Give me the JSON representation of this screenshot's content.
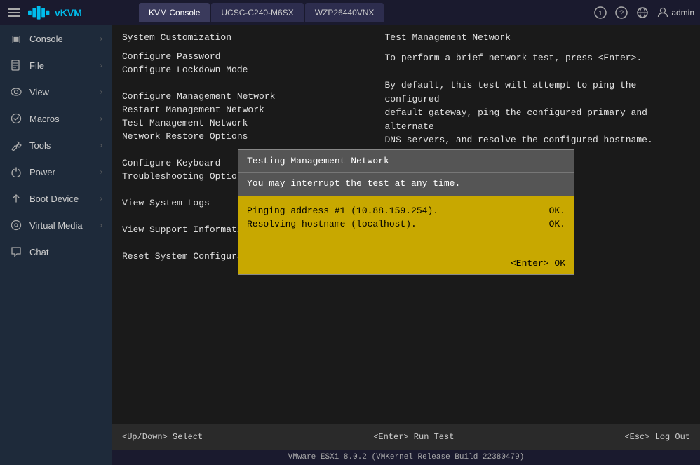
{
  "topbar": {
    "logo_text": "vKVM",
    "tabs": [
      {
        "label": "KVM Console",
        "active": true
      },
      {
        "label": "UCSC-C240-M6SX",
        "active": false
      },
      {
        "label": "WZP26440VNX",
        "active": false
      }
    ],
    "badge_count": "1",
    "user": "admin"
  },
  "sidebar": {
    "items": [
      {
        "label": "Console",
        "icon": "▣",
        "has_arrow": true
      },
      {
        "label": "File",
        "icon": "📄",
        "has_arrow": true
      },
      {
        "label": "View",
        "icon": "👁",
        "has_arrow": true
      },
      {
        "label": "Macros",
        "icon": "⚙",
        "has_arrow": true
      },
      {
        "label": "Tools",
        "icon": "🔧",
        "has_arrow": true
      },
      {
        "label": "Power",
        "icon": "⏻",
        "has_arrow": true
      },
      {
        "label": "Boot Device",
        "icon": "⬆",
        "has_arrow": true
      },
      {
        "label": "Virtual Media",
        "icon": "💿",
        "has_arrow": true
      },
      {
        "label": "Chat",
        "icon": "💬",
        "has_arrow": false
      }
    ]
  },
  "esxi": {
    "left_title": "System Customization",
    "menu_items": [
      "Configure Password",
      "Configure Lockdown Mode",
      "",
      "Configure Management Network",
      "Restart Management Network",
      "Test Management Network",
      "Network Restore Options",
      "",
      "Configure Keyboard",
      "Troubleshooting Options",
      "",
      "View System Logs",
      "",
      "View Support Information",
      "",
      "Reset System Configurati..."
    ],
    "right_title": "Test Management Network",
    "right_desc": "To perform a brief network test, press <Enter>.\n\nBy default, this test will attempt to ping the configured\ndefault gateway, ping the configured primary and alternate\nDNS servers, and resolve the configured hostname."
  },
  "dialog": {
    "title": "Testing Management Network",
    "body_text": "You may interrupt the test at any time.",
    "results": [
      {
        "label": "Pinging address #1 (10.88.159.254).",
        "status": "OK."
      },
      {
        "label": "Resolving hostname (localhost).",
        "status": "OK."
      }
    ],
    "footer": "<Enter> OK"
  },
  "status_bar": {
    "left": "<Up/Down> Select",
    "center": "<Enter> Run Test",
    "right": "<Esc> Log Out"
  },
  "info_bar": {
    "text": "VMware ESXi 8.0.2 (VMKernel Release Build 22380479)"
  }
}
